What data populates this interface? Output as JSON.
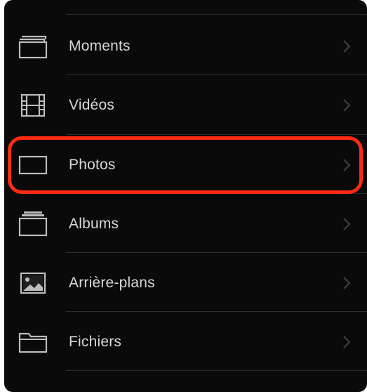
{
  "menu": {
    "items": [
      {
        "label": "Moments",
        "icon": "moments-icon"
      },
      {
        "label": "Vidéos",
        "icon": "film-icon"
      },
      {
        "label": "Photos",
        "icon": "photo-frame-icon"
      },
      {
        "label": "Albums",
        "icon": "albums-icon"
      },
      {
        "label": "Arrière-plans",
        "icon": "wallpaper-icon"
      },
      {
        "label": "Fichiers",
        "icon": "folder-icon"
      }
    ]
  },
  "colors": {
    "background": "#0a0a0a",
    "text": "#d8d8d8",
    "icon": "#bdbdbd",
    "chevron": "#3a3a3c",
    "divider": "#2c2c2e",
    "highlight": "#ff2a14"
  }
}
